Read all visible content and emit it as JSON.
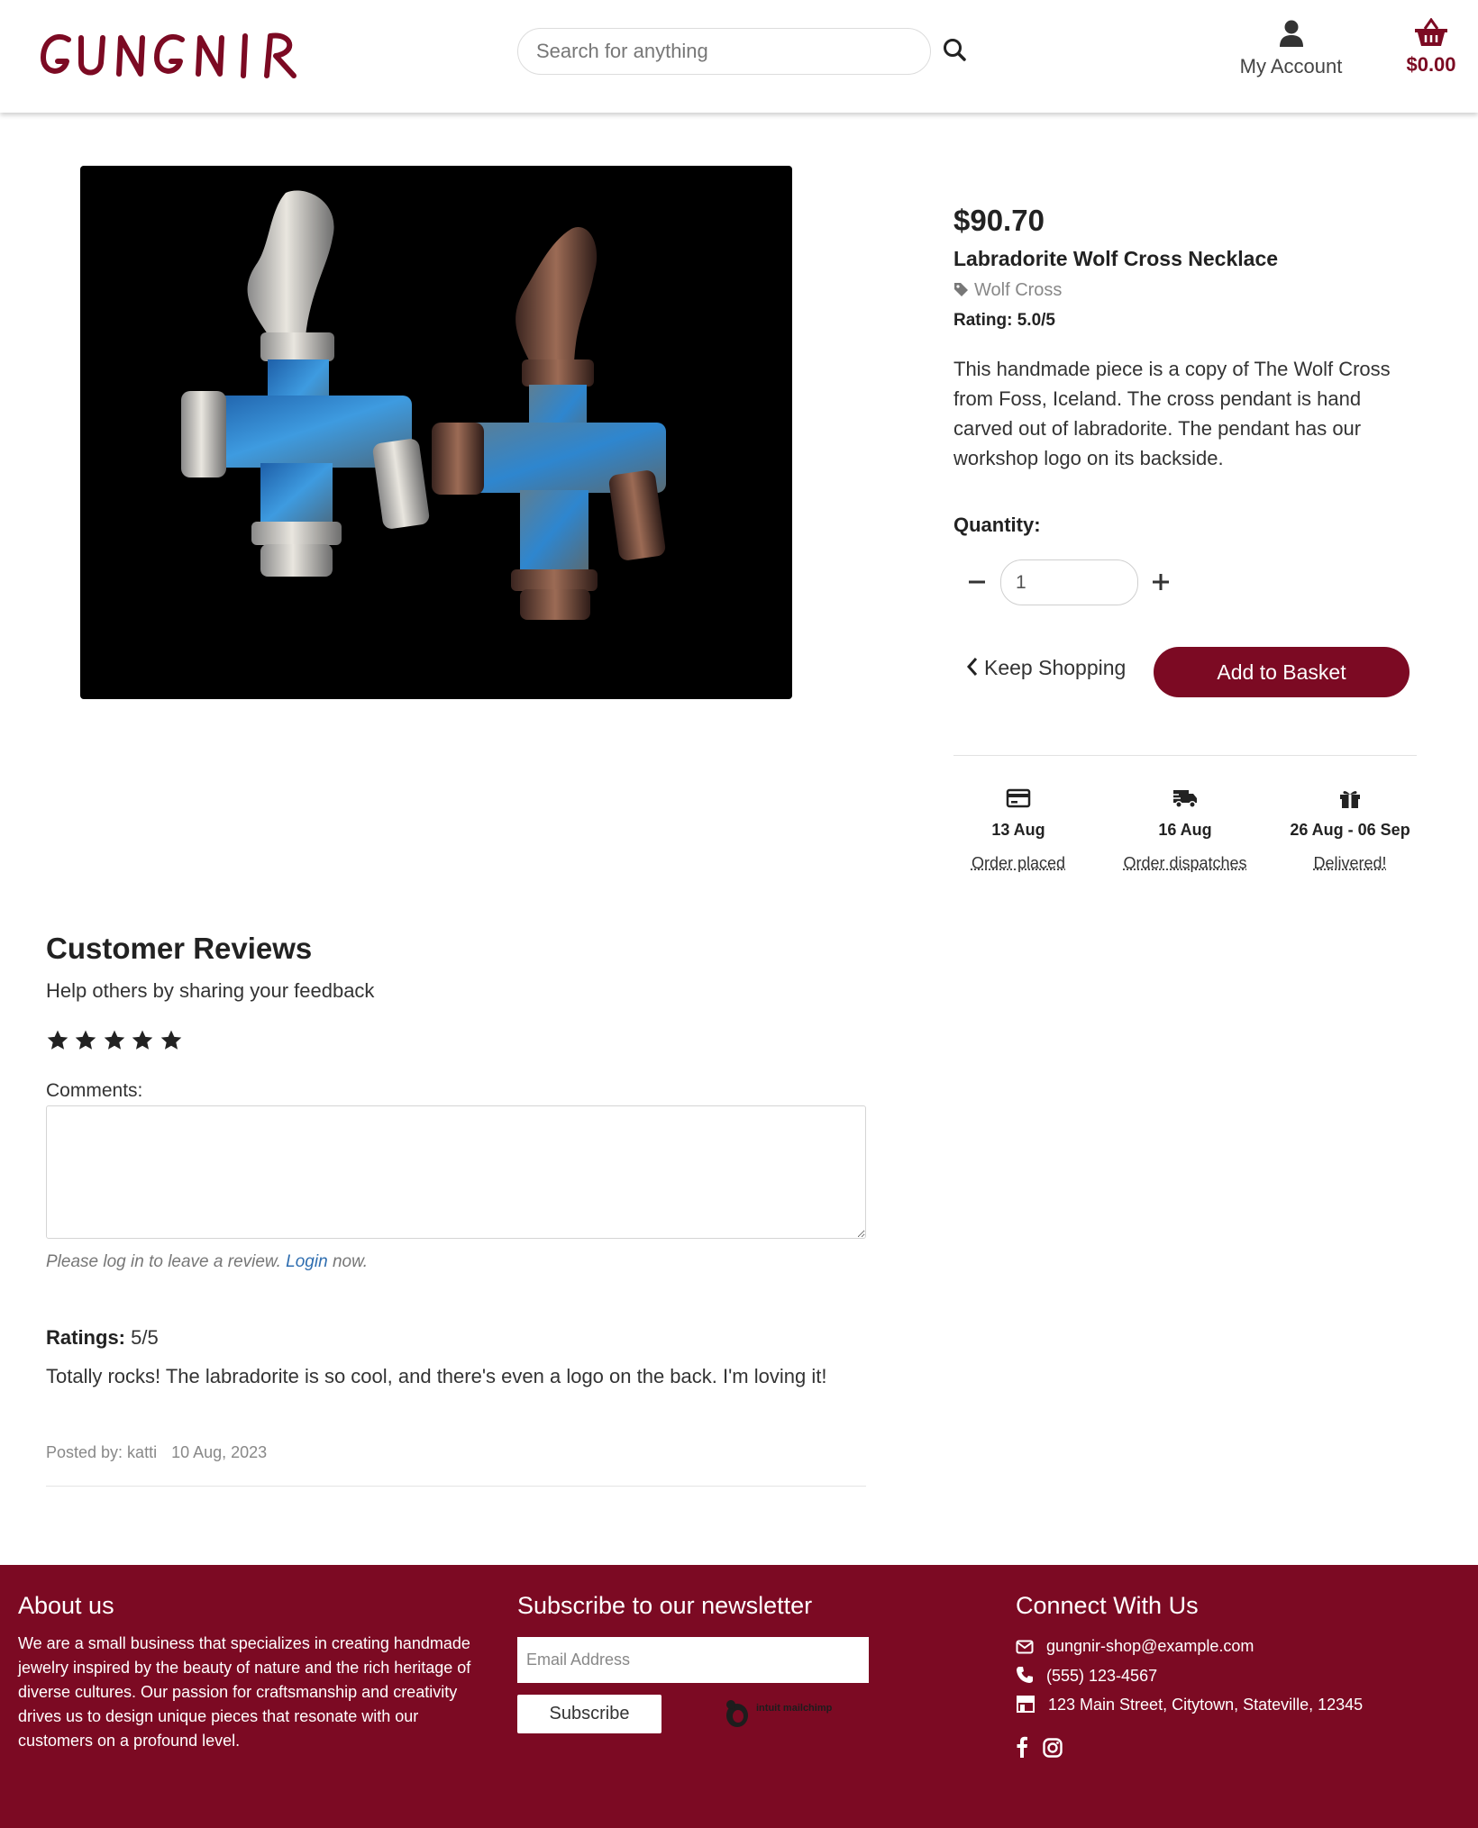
{
  "header": {
    "brand": "GUNGNIR",
    "search_placeholder": "Search for anything",
    "account_label": "My Account",
    "basket_total": "$0.00"
  },
  "product": {
    "price": "$90.70",
    "name": "Labradorite Wolf Cross Necklace",
    "category": "Wolf Cross",
    "rating_label": "Rating:",
    "rating_value": "5.0/5",
    "description": "This handmade piece is a copy of The Wolf Cross from Foss, Iceland. The cross pendant is hand carved out of labradorite. The pendant has our workshop logo on its backside.",
    "quantity_label": "Quantity:",
    "quantity": "1",
    "keep_shopping": "Keep Shopping",
    "add_to_basket": "Add to Basket"
  },
  "delivery": [
    {
      "icon": "credit-card-icon",
      "date": "13 Aug",
      "label": "Order placed"
    },
    {
      "icon": "truck-icon",
      "date": "16 Aug",
      "label": "Order dispatches"
    },
    {
      "icon": "gift-icon",
      "date": "26 Aug - 06 Sep",
      "label": "Delivered!"
    }
  ],
  "reviews": {
    "title": "Customer Reviews",
    "subtitle": "Help others by sharing your feedback",
    "stars": 5,
    "comments_label": "Comments:",
    "login_note_prefix": "Please log in to leave a review.",
    "login_link": "Login",
    "login_note_suffix": "now.",
    "items": [
      {
        "rating_label": "Ratings:",
        "rating": "5/5",
        "text": "Totally rocks! The labradorite is so cool, and there's even a logo on the back. I'm loving it!",
        "posted_by": "Posted by: katti",
        "date": "10 Aug, 2023"
      }
    ]
  },
  "footer": {
    "about_title": "About us",
    "about_text": "We are a small business that specializes in creating handmade jewelry inspired by the beauty of nature and the rich heritage of diverse cultures. Our passion for craftsmanship and creativity drives us to design unique pieces that resonate with our customers on a profound level.",
    "newsletter_title": "Subscribe to our newsletter",
    "email_placeholder": "Email Address",
    "subscribe_label": "Subscribe",
    "mailchimp_brand": "intuit mailchimp",
    "connect_title": "Connect With Us",
    "email": "gungnir-shop@example.com",
    "phone": "(555) 123-4567",
    "address": "123 Main Street, Citytown, Stateville, 12345",
    "social": [
      "facebook-icon",
      "instagram-icon"
    ]
  },
  "colors": {
    "brand": "#7c0a23",
    "link": "#2f6eb0"
  }
}
